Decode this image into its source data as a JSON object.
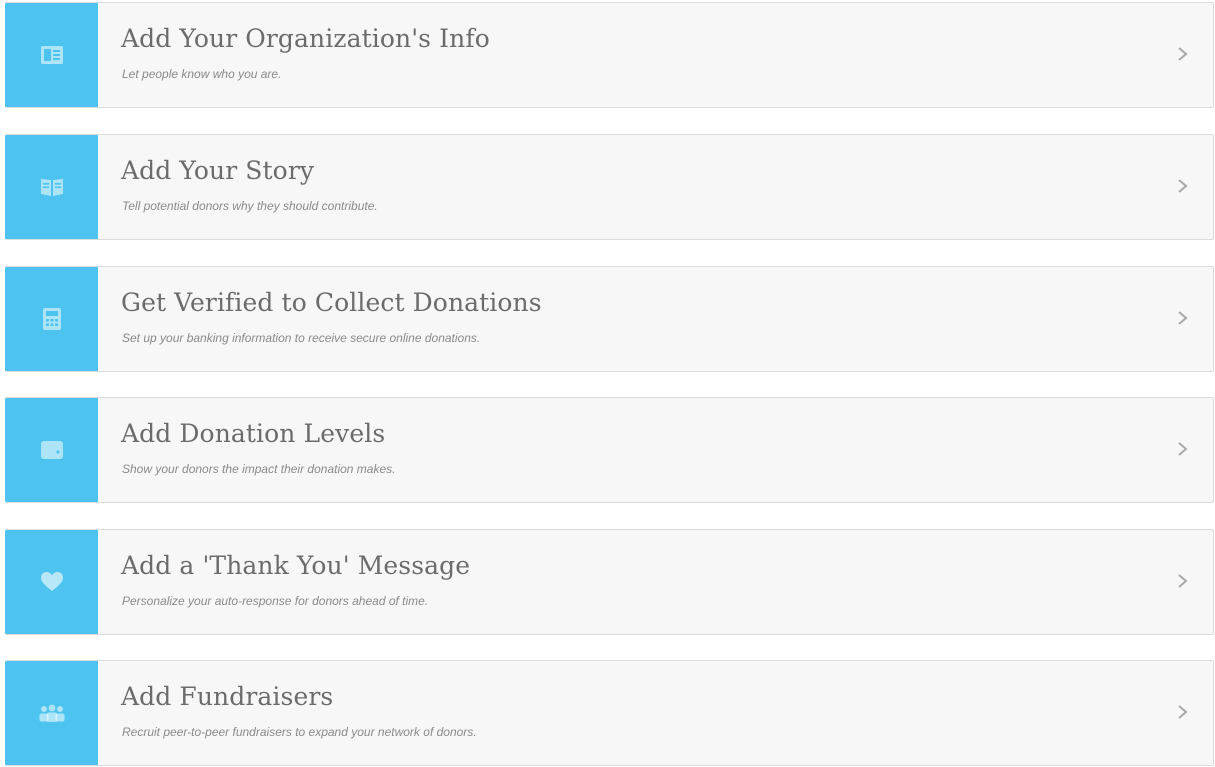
{
  "accent_color": "#4dc3ef",
  "steps": [
    {
      "title": "Add Your Organization's Info",
      "subtitle": "Let people know who you are.",
      "icon": "id-card-icon"
    },
    {
      "title": "Add Your Story",
      "subtitle": "Tell potential donors why they should contribute.",
      "icon": "open-book-icon"
    },
    {
      "title": "Get Verified to Collect Donations",
      "subtitle": "Set up your banking information to receive secure online donations.",
      "icon": "calculator-icon"
    },
    {
      "title": "Add Donation Levels",
      "subtitle": "Show your donors the impact their donation makes.",
      "icon": "wallet-icon"
    },
    {
      "title": "Add a 'Thank You' Message",
      "subtitle": "Personalize your auto-response for donors ahead of time.",
      "icon": "heart-icon"
    },
    {
      "title": "Add Fundraisers",
      "subtitle": "Recruit peer-to-peer fundraisers to expand your network of donors.",
      "icon": "group-icon"
    }
  ]
}
